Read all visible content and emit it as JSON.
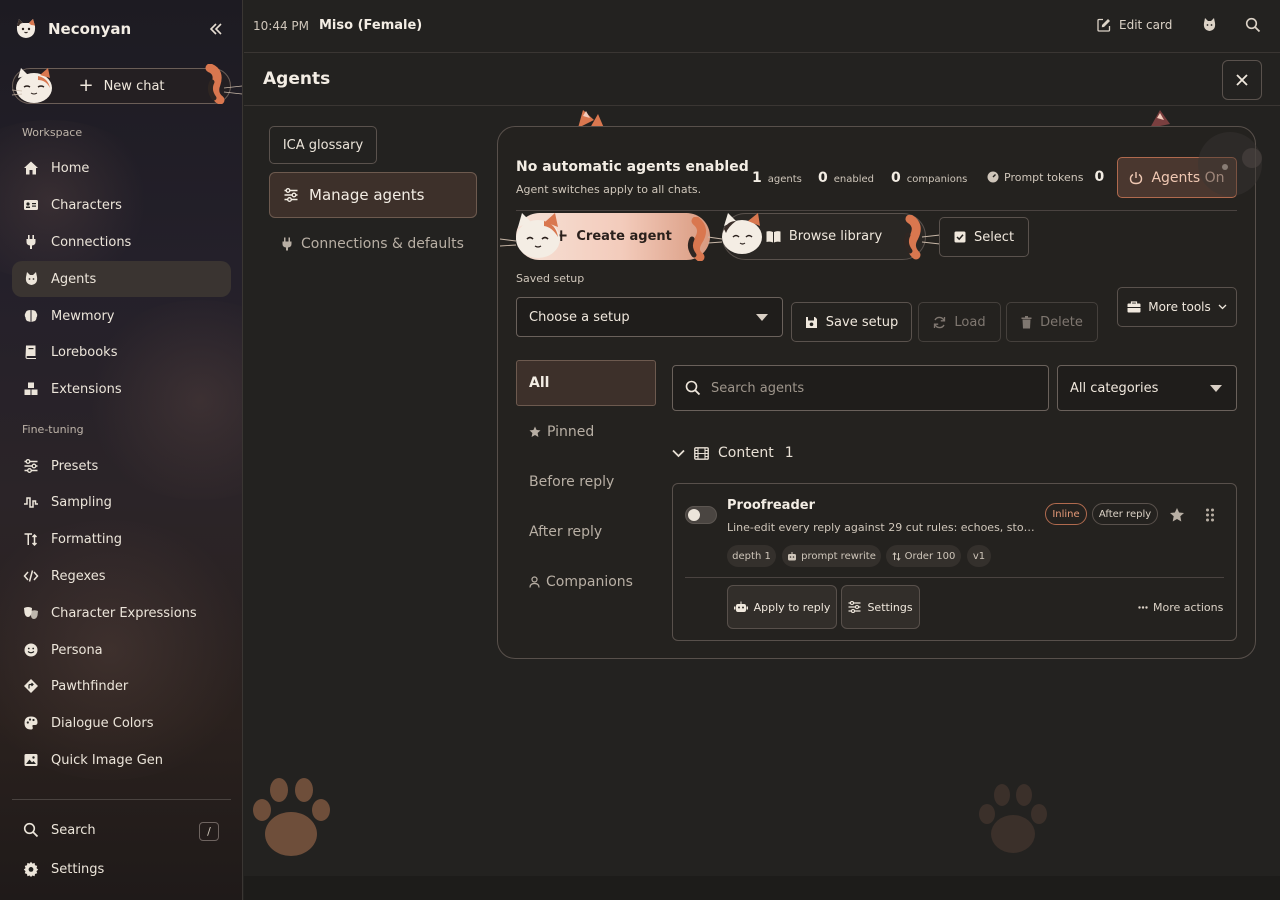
{
  "brand": {
    "name": "Neconyan"
  },
  "sidebar": {
    "new_chat_label": "New chat",
    "workspace_label": "Workspace",
    "workspace_items": [
      {
        "label": "Home",
        "icon": "home-icon"
      },
      {
        "label": "Characters",
        "icon": "id-card-icon"
      },
      {
        "label": "Connections",
        "icon": "plug-icon"
      },
      {
        "label": "Agents",
        "icon": "cat-agent-icon",
        "active": true
      },
      {
        "label": "Mewmory",
        "icon": "brain-icon"
      },
      {
        "label": "Lorebooks",
        "icon": "book-icon"
      },
      {
        "label": "Extensions",
        "icon": "cubes-icon"
      }
    ],
    "finetuning_label": "Fine-tuning",
    "finetuning_items": [
      {
        "label": "Presets",
        "icon": "sliders-icon"
      },
      {
        "label": "Sampling",
        "icon": "wave-icon"
      },
      {
        "label": "Formatting",
        "icon": "text-format-icon"
      },
      {
        "label": "Regexes",
        "icon": "code-icon"
      },
      {
        "label": "Character Expressions",
        "icon": "masks-icon"
      },
      {
        "label": "Persona",
        "icon": "smile-icon"
      },
      {
        "label": "Pawthfinder",
        "icon": "compass-icon"
      },
      {
        "label": "Dialogue Colors",
        "icon": "palette-icon"
      },
      {
        "label": "Quick Image Gen",
        "icon": "image-icon"
      }
    ],
    "search_label": "Search",
    "search_shortcut": "/",
    "settings_label": "Settings"
  },
  "topbar": {
    "time": "10:44 PM",
    "character_name": "Miso (Female)",
    "edit_card_label": "Edit card"
  },
  "panel": {
    "title": "Agents",
    "tabs": {
      "ica_glossary": "ICA glossary",
      "manage_agents": "Manage agents",
      "connections_defaults": "Connections & defaults"
    }
  },
  "status": {
    "title": "No automatic agents enabled",
    "subtitle": "Agent switches apply to all chats.",
    "agents_count": "1",
    "agents_label": "agents",
    "enabled_count": "0",
    "enabled_label": "enabled",
    "companions_count": "0",
    "companions_label": "companions",
    "prompt_tokens_label": "Prompt tokens",
    "prompt_tokens_value": "0",
    "agents_on_label": "Agents On"
  },
  "actions": {
    "create_agent": "Create agent",
    "browse_library": "Browse library",
    "select": "Select",
    "saved_setup_label": "Saved setup",
    "setup_placeholder": "Choose a setup",
    "save_setup": "Save setup",
    "load": "Load",
    "delete": "Delete",
    "more_tools": "More tools"
  },
  "filters": {
    "all": "All",
    "pinned": "Pinned",
    "before_reply": "Before reply",
    "after_reply": "After reply",
    "companions": "Companions"
  },
  "search": {
    "placeholder": "Search agents",
    "category_value": "All categories"
  },
  "group": {
    "name": "Content",
    "count": "1"
  },
  "agent": {
    "name": "Proofreader",
    "description": "Line-edit every reply against 29 cut rules: echoes, stock be...",
    "tag_inline": "Inline",
    "tag_after_reply": "After reply",
    "chip_depth": "depth 1",
    "chip_prompt": "prompt rewrite",
    "chip_order": "Order 100",
    "chip_version": "v1",
    "apply_label": "Apply to reply",
    "settings_label": "Settings",
    "more_actions_label": "More actions",
    "enabled": false
  },
  "colors": {
    "accent": "#b06a4e",
    "active_bg": "#3d302a",
    "background": "#232220"
  }
}
